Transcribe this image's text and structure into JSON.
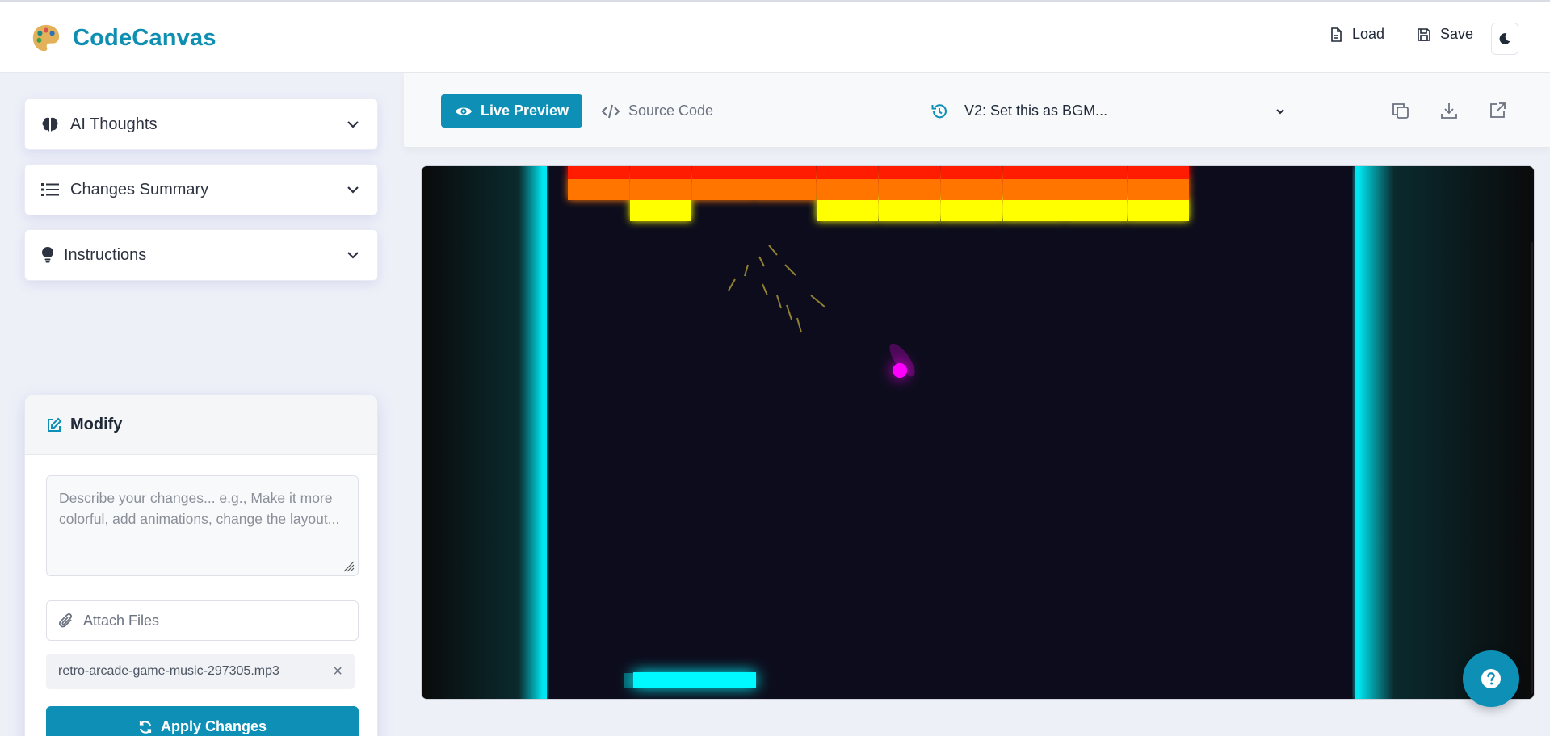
{
  "app": {
    "name": "CodeCanvas"
  },
  "header": {
    "load_label": "Load",
    "save_label": "Save"
  },
  "sidebar": {
    "accordions": [
      {
        "label": "AI Thoughts",
        "icon": "brain-icon"
      },
      {
        "label": "Changes Summary",
        "icon": "list-icon"
      },
      {
        "label": "Instructions",
        "icon": "lightbulb-icon"
      }
    ],
    "modify": {
      "title": "Modify",
      "placeholder": "Describe your changes... e.g., Make it more colorful, add animations, change the layout...",
      "attach_label": "Attach Files",
      "attached_file": "retro-arcade-game-music-297305.mp3",
      "apply_label": "Apply Changes"
    }
  },
  "main": {
    "tabs": [
      {
        "label": "Live Preview",
        "active": true
      },
      {
        "label": "Source Code",
        "active": false
      }
    ],
    "version_label": "V2: Set this as BGM...",
    "toolbar_icons": [
      "copy-icon",
      "download-icon",
      "external-link-icon"
    ]
  },
  "colors": {
    "brand": "#0e8fb1",
    "primary": "#0e8fb6",
    "game_bg": "#0c0c1c",
    "wall": "#00e5f0",
    "brick_red": "#ff1a00",
    "brick_orange": "#ff7400",
    "brick_yellow": "#ffff00",
    "ball": "#ff00ff",
    "paddle": "#00f8ff"
  }
}
